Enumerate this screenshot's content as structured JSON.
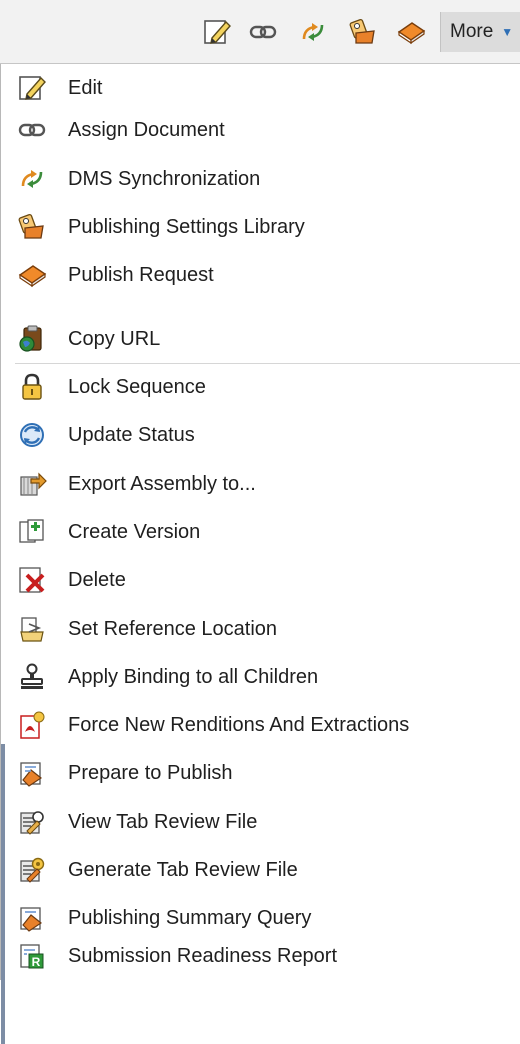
{
  "toolbar": {
    "icons": [
      "edit-icon",
      "assign-document-icon",
      "dms-synchronization-icon",
      "publishing-settings-library-icon",
      "publish-request-icon"
    ],
    "more_label": "More"
  },
  "menu": {
    "items": [
      {
        "label": "Edit",
        "icon": "edit-icon"
      },
      {
        "label": "Assign Document",
        "icon": "chain-link-icon"
      },
      {
        "label": "DMS Synchronization",
        "icon": "sync-arrows-icon"
      },
      {
        "label": "Publishing Settings Library",
        "icon": "settings-library-icon"
      },
      {
        "label": "Publish Request",
        "icon": "book-icon"
      },
      {
        "label": "Copy URL",
        "icon": "clipboard-globe-icon"
      },
      {
        "label": "Lock Sequence",
        "icon": "padlock-icon"
      },
      {
        "label": "Update Status",
        "icon": "refresh-icon"
      },
      {
        "label": "Export Assembly to...",
        "icon": "export-icon"
      },
      {
        "label": "Create Version",
        "icon": "new-version-icon"
      },
      {
        "label": "Delete",
        "icon": "delete-x-icon"
      },
      {
        "label": "Set Reference Location",
        "icon": "reference-location-icon"
      },
      {
        "label": "Apply Binding to all Children",
        "icon": "stamp-icon"
      },
      {
        "label": "Force New Renditions And Extractions",
        "icon": "pdf-renditions-icon"
      },
      {
        "label": "Prepare to Publish",
        "icon": "prepare-publish-icon"
      },
      {
        "label": "View Tab Review File",
        "icon": "view-review-file-icon"
      },
      {
        "label": "Generate Tab Review File",
        "icon": "generate-review-file-icon"
      },
      {
        "label": "Publishing Summary Query",
        "icon": "summary-query-icon"
      },
      {
        "label": "Submission Readiness Report",
        "icon": "readiness-report-icon"
      }
    ]
  },
  "colors": {
    "toolbar_bg": "#f2f2f2",
    "more_bg": "#dcdcdc",
    "accent_blue": "#2f6fb5",
    "text": "#1f1f1f"
  }
}
